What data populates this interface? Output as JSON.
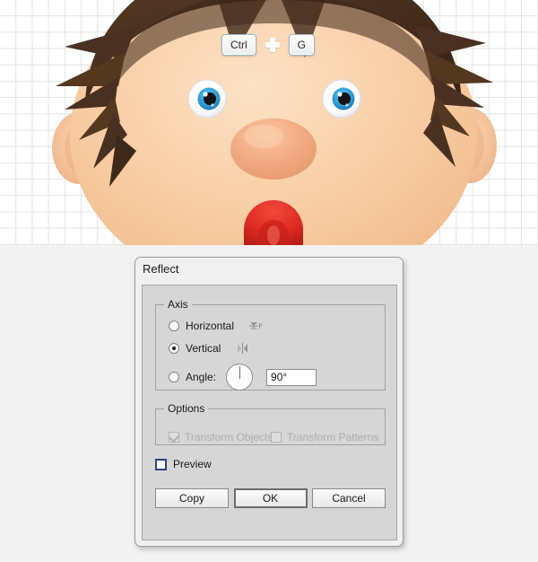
{
  "canvas": {
    "grid_enabled": true,
    "background_color": "#ffffff",
    "grid_color": "#e3e3e6",
    "illustration": {
      "name": "cartoon-baby-face",
      "hair_color": "#4c3221",
      "hair_highlight": "#6b4a31",
      "skin_color": "#f6c79c",
      "skin_highlight": "#fbdcbd",
      "nose_color": "#f0a980",
      "eye_sclera": "#ffffff",
      "eye_iris": "#2e9ad6",
      "eye_pupil": "#141414",
      "mouth_color": "#e02b22"
    }
  },
  "shortcut": {
    "key1": "Ctrl",
    "separator": "plus-icon",
    "key2": "G"
  },
  "dialog": {
    "title": "Reflect",
    "axis": {
      "legend": "Axis",
      "options": [
        {
          "label": "Horizontal",
          "selected": false,
          "icon": "reflect-horizontal-icon"
        },
        {
          "label": "Vertical",
          "selected": true,
          "icon": "reflect-vertical-icon"
        }
      ],
      "angle": {
        "label": "Angle:",
        "selected": false,
        "dial_icon": "angle-dial-icon",
        "value": "90°",
        "placeholder": "0°"
      }
    },
    "options": {
      "legend": "Options",
      "items": [
        {
          "label": "Transform Objects",
          "checked": true,
          "disabled": true
        },
        {
          "label": "Transform Patterns",
          "checked": false,
          "disabled": true
        }
      ]
    },
    "preview": {
      "label": "Preview",
      "checked": false,
      "accent_color": "#33417d"
    },
    "buttons": [
      {
        "label": "Copy",
        "default": false
      },
      {
        "label": "OK",
        "default": true
      },
      {
        "label": "Cancel",
        "default": false
      }
    ]
  }
}
